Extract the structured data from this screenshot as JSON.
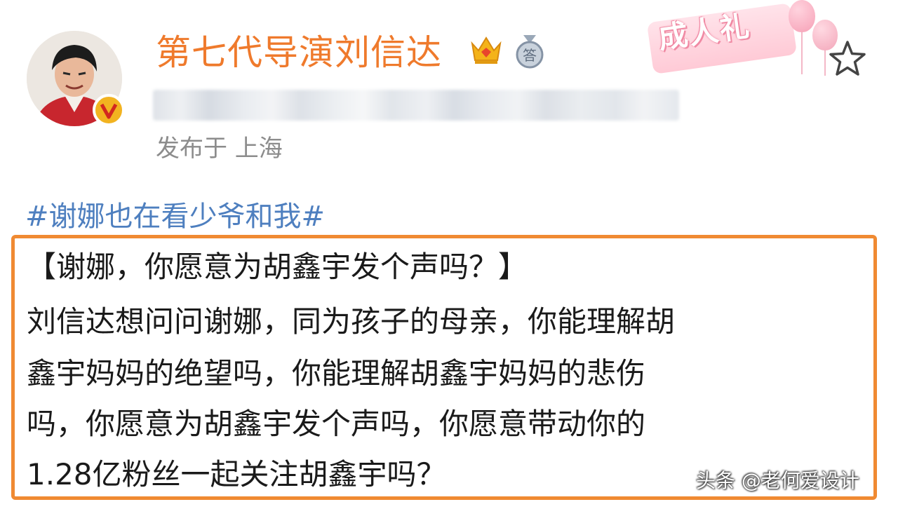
{
  "header": {
    "username": "第七代导演刘信达",
    "location_text": "发布于 上海",
    "medal_char": "答"
  },
  "decoration": {
    "banner_text": "成人礼"
  },
  "post": {
    "hashtag": "#谢娜也在看少爷和我#",
    "quote_title": "【谢娜，你愿意为胡鑫宇发个声吗？】",
    "lines": [
      "刘信达想问问谢娜，同为孩子的母亲，你能理解胡",
      "鑫宇妈妈的绝望吗，你能理解胡鑫宇妈妈的悲伤",
      "吗，你愿意为胡鑫宇发个声吗，你愿意带动你的",
      "1.28亿粉丝一起关注胡鑫宇吗？"
    ]
  },
  "watermark": "头条 @老何爱设计",
  "colors": {
    "username": "#ef7a2c",
    "hashtag": "#4e7fbf",
    "box_border": "#f08a32",
    "location": "#8c8c8c"
  },
  "icons": {
    "crown": "crown-icon",
    "medal": "medal-icon",
    "verified": "verified-badge-icon",
    "star": "star-icon"
  }
}
